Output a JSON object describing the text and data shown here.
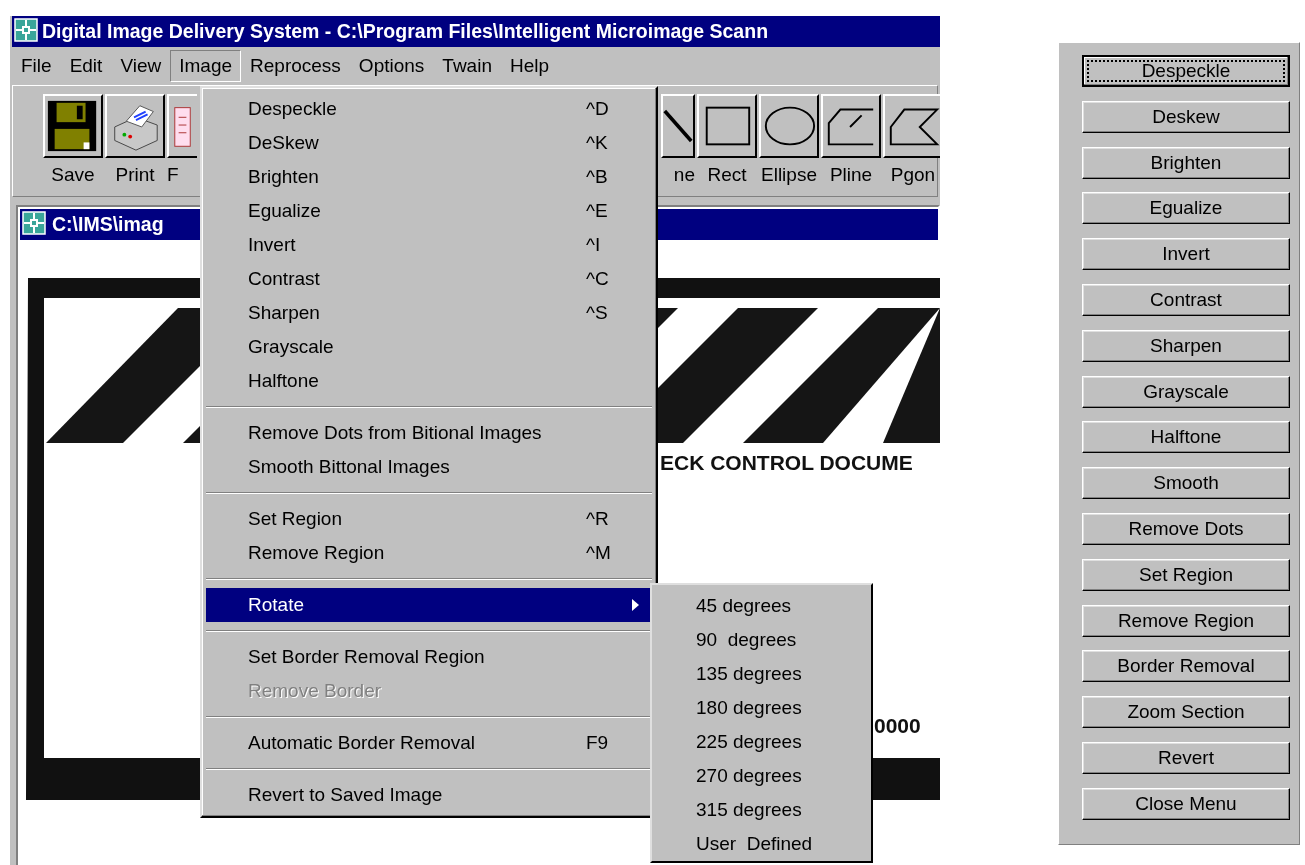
{
  "window": {
    "title": "Digital Image Delivery System - C:\\Program Files\\Intelligent Microimage Scann"
  },
  "menu_bar": [
    {
      "label": "File",
      "selected": false
    },
    {
      "label": "Edit",
      "selected": false
    },
    {
      "label": "View",
      "selected": false
    },
    {
      "label": "Image",
      "selected": true
    },
    {
      "label": "Reprocess",
      "selected": false
    },
    {
      "label": "Options",
      "selected": false
    },
    {
      "label": "Twain",
      "selected": false
    },
    {
      "label": "Help",
      "selected": false
    }
  ],
  "toolbar": {
    "left": [
      {
        "kind": "save",
        "label": "Save"
      },
      {
        "kind": "print",
        "label": "Print"
      },
      {
        "kind": "fax",
        "label": "F"
      }
    ],
    "right": [
      {
        "kind": "line",
        "label": "ne"
      },
      {
        "kind": "rect",
        "label": "Rect"
      },
      {
        "kind": "ellipse",
        "label": "Ellipse"
      },
      {
        "kind": "pline",
        "label": "Pline"
      },
      {
        "kind": "pgon",
        "label": "Pgon"
      }
    ]
  },
  "document_window": {
    "title": "C:\\IMS\\imag",
    "image_text": [
      "ECK CONTROL DOCUME",
      "0000"
    ]
  },
  "image_menu": [
    {
      "kind": "item",
      "label": "Despeckle",
      "shortcut": "^D",
      "selected": false,
      "disabled": false
    },
    {
      "kind": "item",
      "label": "DeSkew",
      "shortcut": "^K",
      "selected": false,
      "disabled": false
    },
    {
      "kind": "item",
      "label": "Brighten",
      "shortcut": "^B",
      "selected": false,
      "disabled": false
    },
    {
      "kind": "item",
      "label": "Egualize",
      "shortcut": "^E",
      "selected": false,
      "disabled": false
    },
    {
      "kind": "item",
      "label": "Invert",
      "shortcut": "^I",
      "selected": false,
      "disabled": false
    },
    {
      "kind": "item",
      "label": "Contrast",
      "shortcut": "^C",
      "selected": false,
      "disabled": false
    },
    {
      "kind": "item",
      "label": "Sharpen",
      "shortcut": "^S",
      "selected": false,
      "disabled": false
    },
    {
      "kind": "item",
      "label": "Grayscale",
      "selected": false,
      "disabled": false
    },
    {
      "kind": "item",
      "label": "Halftone",
      "selected": false,
      "disabled": false
    },
    {
      "kind": "separator"
    },
    {
      "kind": "item",
      "label": "Remove Dots from Bitional Images",
      "selected": false,
      "disabled": false
    },
    {
      "kind": "item",
      "label": "Smooth Bittonal Images",
      "selected": false,
      "disabled": false
    },
    {
      "kind": "separator"
    },
    {
      "kind": "item",
      "label": "Set Region",
      "shortcut": "^R",
      "selected": false,
      "disabled": false
    },
    {
      "kind": "item",
      "label": "Remove Region",
      "shortcut": "^M",
      "selected": false,
      "disabled": false
    },
    {
      "kind": "separator"
    },
    {
      "kind": "item",
      "label": "Rotate",
      "selected": true,
      "disabled": false,
      "has_submenu": true
    },
    {
      "kind": "separator"
    },
    {
      "kind": "item",
      "label": "Set Border Removal Region",
      "selected": false,
      "disabled": false
    },
    {
      "kind": "item",
      "label": "Remove Border",
      "selected": false,
      "disabled": true
    },
    {
      "kind": "separator"
    },
    {
      "kind": "item",
      "label": "Automatic Border Removal",
      "shortcut": "F9",
      "selected": false,
      "disabled": false
    },
    {
      "kind": "separator"
    },
    {
      "kind": "item",
      "label": "Revert to Saved Image",
      "selected": false,
      "disabled": false
    }
  ],
  "rotate_submenu": [
    {
      "label": "45 degrees"
    },
    {
      "label": "90  degrees"
    },
    {
      "label": "135 degrees"
    },
    {
      "label": "180 degrees"
    },
    {
      "label": "225 degrees"
    },
    {
      "label": "270 degrees"
    },
    {
      "label": "315 degrees"
    },
    {
      "label": "User  Defined"
    }
  ],
  "tool_panel": [
    {
      "label": "Despeckle",
      "focused": true
    },
    {
      "label": "Deskew",
      "focused": false
    },
    {
      "label": "Brighten",
      "focused": false
    },
    {
      "label": "Egualize",
      "focused": false
    },
    {
      "label": "Invert",
      "focused": false
    },
    {
      "label": "Contrast",
      "focused": false
    },
    {
      "label": "Sharpen",
      "focused": false
    },
    {
      "label": "Grayscale",
      "focused": false
    },
    {
      "label": "Halftone",
      "focused": false
    },
    {
      "label": "Smooth",
      "focused": false
    },
    {
      "label": "Remove Dots",
      "focused": false
    },
    {
      "label": "Set Region",
      "focused": false
    },
    {
      "label": "Remove Region",
      "focused": false
    },
    {
      "label": "Border Removal",
      "focused": false
    },
    {
      "label": "Zoom Section",
      "focused": false
    },
    {
      "label": "Revert",
      "focused": false
    },
    {
      "label": "Close Menu",
      "focused": false
    }
  ]
}
